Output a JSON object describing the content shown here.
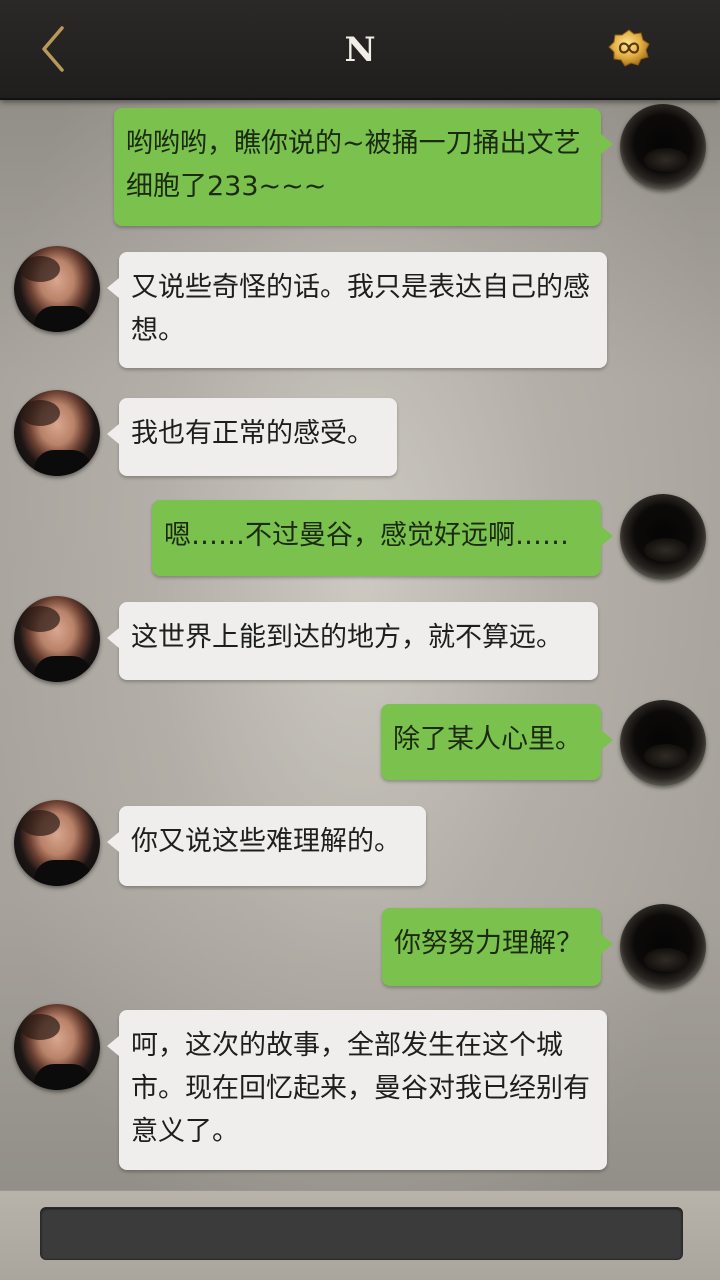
{
  "header": {
    "title": "N",
    "back_icon": "chevron-left-icon",
    "badge_icon": "infinity-coin-icon",
    "accent_color": "#b89a58"
  },
  "messages": [
    {
      "side": "out",
      "text": "哟哟哟，瞧你说的~被捅一刀捅出文艺细胞了233~~~"
    },
    {
      "side": "in",
      "text": "又说些奇怪的话。我只是表达自己的感想。"
    },
    {
      "side": "in",
      "text": "我也有正常的感受。"
    },
    {
      "side": "out",
      "text": "嗯……不过曼谷，感觉好远啊……"
    },
    {
      "side": "in",
      "text": "这世界上能到达的地方，就不算远。"
    },
    {
      "side": "out",
      "text": "除了某人心里。"
    },
    {
      "side": "in",
      "text": "你又说这些难理解的。"
    },
    {
      "side": "out",
      "text": "你努努力理解？"
    },
    {
      "side": "in",
      "text": "呵，这次的故事，全部发生在这个城市。现在回忆起来，曼谷对我已经别有意义了。"
    }
  ],
  "colors": {
    "outgoing_bubble": "#7ac14d",
    "incoming_bubble": "#efeeec",
    "header_bg": "#222120"
  }
}
